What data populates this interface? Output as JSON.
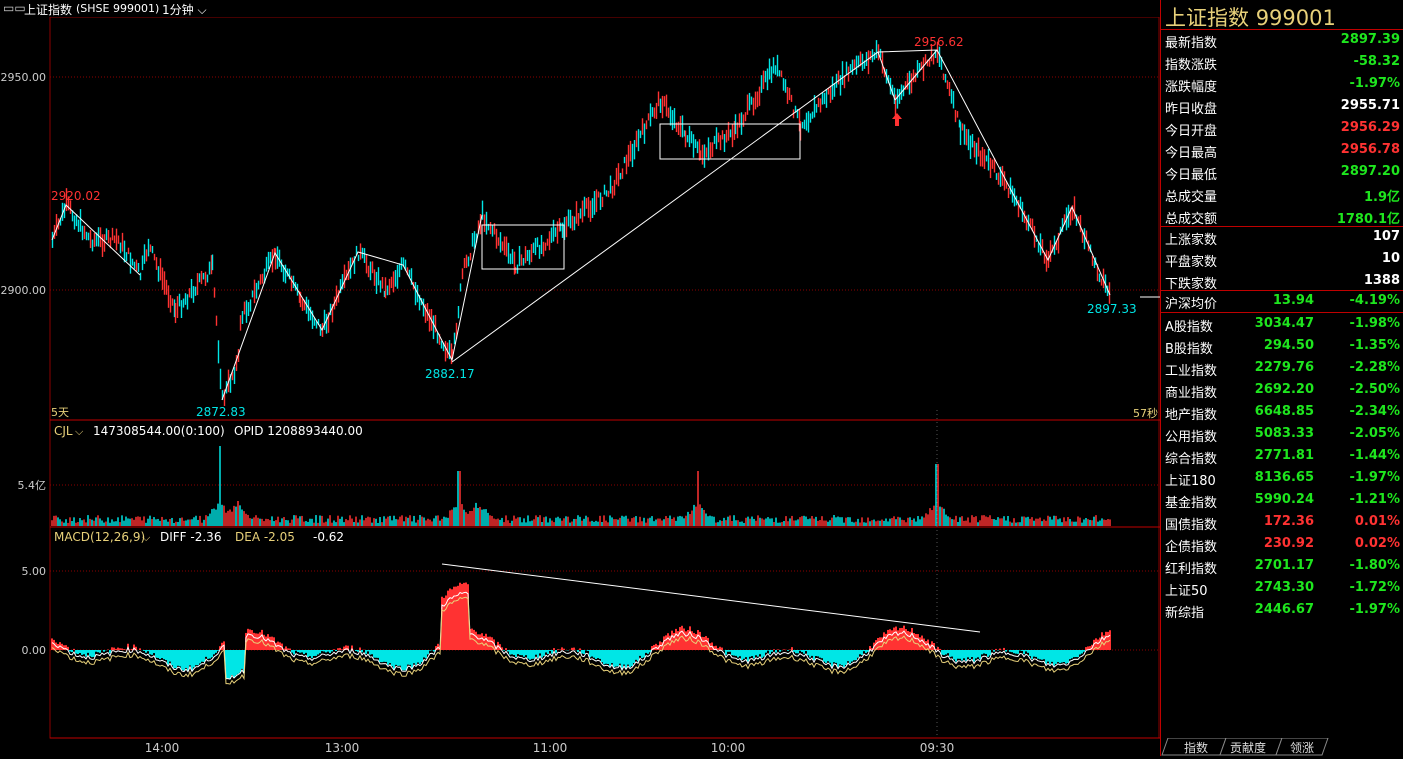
{
  "header": {
    "window_icon": "rectangles-icon",
    "title": "上证指数",
    "code": "(SHSE 999001)",
    "period": "1分钟"
  },
  "price_chart": {
    "y_ticks": [
      "2950.00",
      "2900.00"
    ],
    "annotations": {
      "open_high": "2920.02",
      "low1": "2872.83",
      "low2": "2882.17",
      "high": "2956.62",
      "last": "2897.33"
    },
    "left_corner_label": "5天",
    "right_corner_label": "57秒"
  },
  "volume_chart": {
    "indicator": "CJL",
    "value_text": "147308544.00(0:100)",
    "opid_text": "OPID 1208893440.00",
    "y_tick": "5.4亿"
  },
  "macd_chart": {
    "indicator": "MACD(12,26,9)",
    "diff_text": "DIFF -2.36",
    "dea_text": "DEA -2.05",
    "macd_text": "-0.62",
    "y_ticks": [
      "5.00",
      "0.00"
    ]
  },
  "time_axis": [
    "14:00",
    "13:00",
    "11:00",
    "10:00",
    "09:30"
  ],
  "panel": {
    "title": "上证指数",
    "code": "999001",
    "quote": [
      {
        "label": "最新指数",
        "value": "2897.39",
        "color": "green"
      },
      {
        "label": "指数涨跌",
        "value": "-58.32",
        "color": "green"
      },
      {
        "label": "涨跌幅度",
        "value": "-1.97%",
        "color": "green"
      },
      {
        "label": "昨日收盘",
        "value": "2955.71",
        "color": "white"
      },
      {
        "label": "今日开盘",
        "value": "2956.29",
        "color": "red"
      },
      {
        "label": "今日最高",
        "value": "2956.78",
        "color": "red"
      },
      {
        "label": "今日最低",
        "value": "2897.20",
        "color": "green"
      },
      {
        "label": "总成交量",
        "value": "1.9亿",
        "color": "green"
      },
      {
        "label": "总成交额",
        "value": "1780.1亿",
        "color": "green"
      }
    ],
    "breadth": [
      {
        "label": "上涨家数",
        "value": "107"
      },
      {
        "label": "平盘家数",
        "value": "10"
      },
      {
        "label": "下跌家数",
        "value": "1388"
      }
    ],
    "avg": {
      "label": "沪深均价",
      "value": "13.94",
      "pct": "-4.19%"
    },
    "indices": [
      {
        "label": "A股指数",
        "value": "3034.47",
        "pct": "-1.98%",
        "color": "green"
      },
      {
        "label": "B股指数",
        "value": "294.50",
        "pct": "-1.35%",
        "color": "green"
      },
      {
        "label": "工业指数",
        "value": "2279.76",
        "pct": "-2.28%",
        "color": "green"
      },
      {
        "label": "商业指数",
        "value": "2692.20",
        "pct": "-2.50%",
        "color": "green"
      },
      {
        "label": "地产指数",
        "value": "6648.85",
        "pct": "-2.34%",
        "color": "green"
      },
      {
        "label": "公用指数",
        "value": "5083.33",
        "pct": "-2.05%",
        "color": "green"
      },
      {
        "label": "综合指数",
        "value": "2771.81",
        "pct": "-1.44%",
        "color": "green"
      },
      {
        "label": "上证180",
        "value": "8136.65",
        "pct": "-1.97%",
        "color": "green"
      },
      {
        "label": "基金指数",
        "value": "5990.24",
        "pct": "-1.21%",
        "color": "green"
      },
      {
        "label": "国债指数",
        "value": "172.36",
        "pct": "0.01%",
        "color": "red"
      },
      {
        "label": "企债指数",
        "value": "230.92",
        "pct": "0.02%",
        "color": "red"
      },
      {
        "label": "红利指数",
        "value": "2701.17",
        "pct": "-1.80%",
        "color": "green"
      },
      {
        "label": "上证50",
        "value": "2743.30",
        "pct": "-1.72%",
        "color": "green"
      },
      {
        "label": "新综指",
        "value": "2446.67",
        "pct": "-1.97%",
        "color": "green"
      }
    ],
    "tabs": [
      "指数",
      "贡献度",
      "领涨"
    ]
  },
  "colors": {
    "up": "#ff3232",
    "down": "#00e6e6",
    "grid": "#8b0000",
    "text_yellow": "#e8d17a"
  },
  "chart_data": {
    "type": "candlestick",
    "time_axis_ticks": [
      "14:00",
      "13:00",
      "11:00",
      "10:00",
      "09:30"
    ],
    "price_ticks": [
      2950.0,
      2900.0
    ],
    "marked_prices": {
      "2920.02": "open peak",
      "2872.83": "low",
      "2882.17": "swing low",
      "2956.62": "high",
      "2897.33": "last"
    },
    "price_path_right_to_left": [
      2955.7,
      2956.6,
      2945,
      2930,
      2915,
      2905,
      2920,
      2900,
      2897.3
    ],
    "volume_tick": "5.4亿",
    "macd_ticks": [
      5.0,
      0.0
    ],
    "macd_values": {
      "DIFF": -2.36,
      "DEA": -2.05,
      "MACD": -0.62
    }
  }
}
